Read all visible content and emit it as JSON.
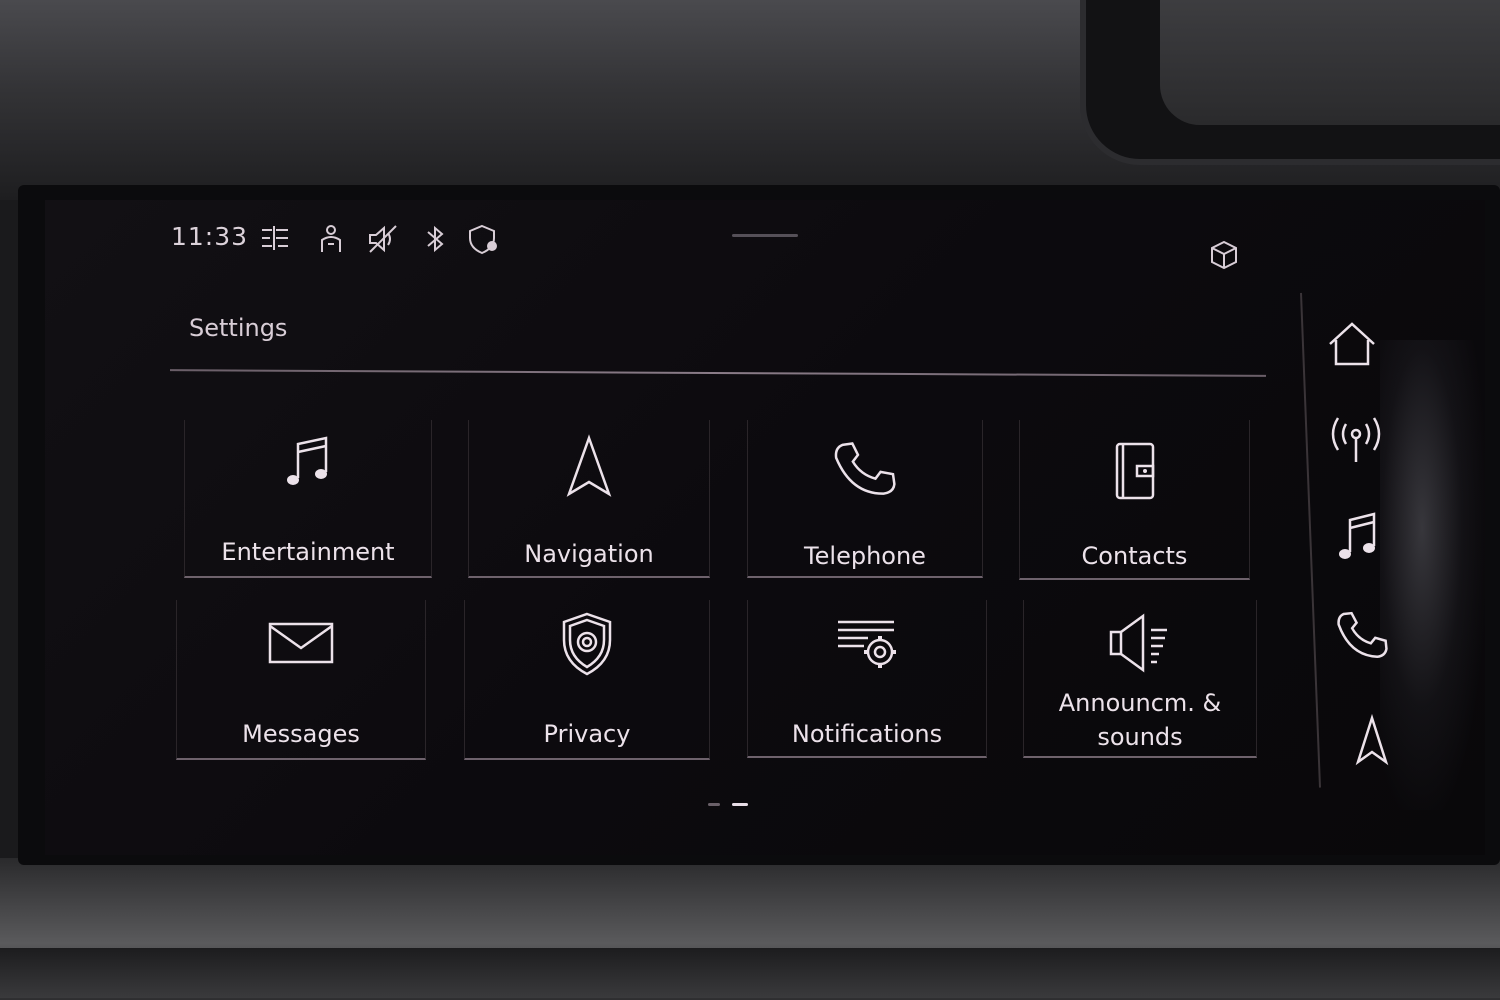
{
  "status_bar": {
    "time": "11:33",
    "icons": [
      "traffic-info-icon",
      "passenger-icon",
      "mute-icon",
      "bluetooth-icon",
      "location-shield-icon"
    ],
    "right_icon": "cube-icon"
  },
  "page": {
    "title": "Settings"
  },
  "tiles": [
    {
      "label": "Entertainment",
      "icon": "music-note-icon"
    },
    {
      "label": "Navigation",
      "icon": "navigation-arrow-icon"
    },
    {
      "label": "Telephone",
      "icon": "phone-icon"
    },
    {
      "label": "Contacts",
      "icon": "contacts-book-icon"
    },
    {
      "label": "Messages",
      "icon": "envelope-icon"
    },
    {
      "label": "Privacy",
      "icon": "privacy-shield-gear-icon"
    },
    {
      "label": "Notifications",
      "icon": "notifications-gear-icon"
    },
    {
      "label": "Announcm. & sounds",
      "label_line1": "Announcm. &",
      "label_line2": "sounds",
      "icon": "speaker-icon"
    }
  ],
  "rail": {
    "items": [
      "home-icon",
      "radio-antenna-icon",
      "music-note-icon",
      "phone-icon",
      "navigation-arrow-icon"
    ]
  },
  "pager": {
    "pages": 2,
    "current": 2
  },
  "colors": {
    "text": "#ece2ea",
    "accent_line": "#8a7c88",
    "background": "#0c0a0e"
  }
}
